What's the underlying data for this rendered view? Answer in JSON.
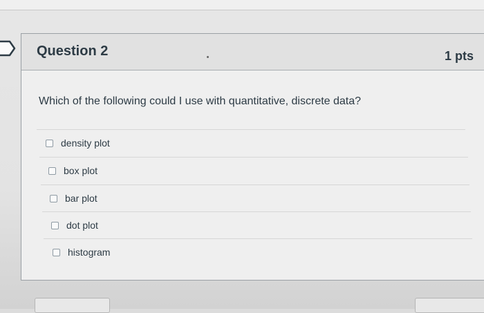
{
  "question": {
    "title": "Question 2",
    "points": "1 pts",
    "text": "Which of the following could I use with quantitative, discrete data?",
    "answers": [
      {
        "label": "density plot"
      },
      {
        "label": "box plot"
      },
      {
        "label": "bar plot"
      },
      {
        "label": "dot plot"
      },
      {
        "label": "histogram"
      }
    ]
  },
  "colors": {
    "text": "#2d3b45",
    "header_bg": "#e1e1e1",
    "card_bg": "#efefef"
  },
  "icons": [
    "bookmark-icon",
    "checkbox-icon"
  ]
}
